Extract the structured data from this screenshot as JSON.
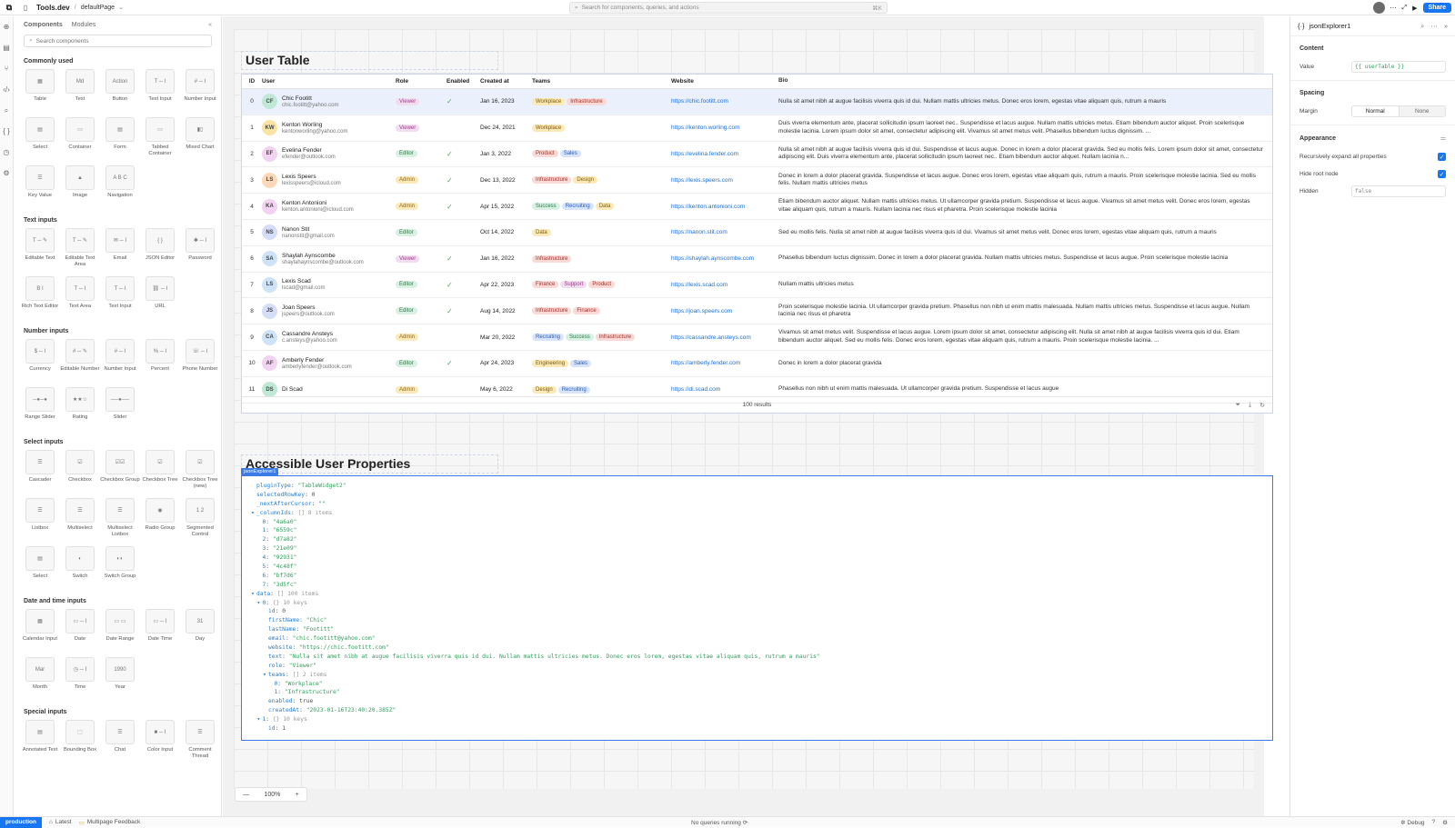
{
  "topbar": {
    "app_name": "Tools.dev",
    "separator": "/",
    "page_name": "defaultPage",
    "search_placeholder": "Search for components, queries, and actions",
    "search_shortcut": "⌘K",
    "share_label": "Share"
  },
  "left": {
    "tabs": [
      "Components",
      "Modules"
    ],
    "search_placeholder": "Search components",
    "cat_common": "Commonly used",
    "common": [
      {
        "l": "Table",
        "t": "▦"
      },
      {
        "l": "Text",
        "t": "Md"
      },
      {
        "l": "Button",
        "t": "Action"
      },
      {
        "l": "Text Input",
        "t": "T ─ I"
      },
      {
        "l": "Number Input",
        "t": "# ─ I"
      },
      {
        "l": "Select",
        "t": "▤"
      },
      {
        "l": "Container",
        "t": "▭"
      },
      {
        "l": "Form",
        "t": "▤"
      },
      {
        "l": "Tabbed Container",
        "t": "▭"
      },
      {
        "l": "Mixed Chart",
        "t": "▮▯"
      },
      {
        "l": "Key Value",
        "t": "☰"
      },
      {
        "l": "Image",
        "t": "▲"
      },
      {
        "l": "Navigation",
        "t": "A B C"
      }
    ],
    "cat_text": "Text inputs",
    "text": [
      {
        "l": "Editable Text",
        "t": "T ─ ✎"
      },
      {
        "l": "Editable Text Area",
        "t": "T ─ ✎"
      },
      {
        "l": "Email",
        "t": "✉ ─ I"
      },
      {
        "l": "JSON Editor",
        "t": "{ }"
      },
      {
        "l": "Password",
        "t": "✱ ─ I"
      },
      {
        "l": "Rich Text Editor",
        "t": "B I"
      },
      {
        "l": "Text Area",
        "t": "T ─ I"
      },
      {
        "l": "Text Input",
        "t": "T ─ I"
      },
      {
        "l": "URL",
        "t": "⛓ ─ I"
      }
    ],
    "cat_number": "Number inputs",
    "number": [
      {
        "l": "Currency",
        "t": "$ ─ I"
      },
      {
        "l": "Editable Number",
        "t": "# ─ ✎"
      },
      {
        "l": "Number Input",
        "t": "# ─ I"
      },
      {
        "l": "Percent",
        "t": "% ─ I"
      },
      {
        "l": "Phone Number",
        "t": "☏ ─ I"
      },
      {
        "l": "Range Slider",
        "t": "─●─●"
      },
      {
        "l": "Rating",
        "t": "★★☆"
      },
      {
        "l": "Slider",
        "t": "──●──"
      }
    ],
    "cat_select": "Select inputs",
    "select": [
      {
        "l": "Cascader",
        "t": "☰"
      },
      {
        "l": "Checkbox",
        "t": "☑"
      },
      {
        "l": "Checkbox Group",
        "t": "☑☑"
      },
      {
        "l": "Checkbox Tree",
        "t": "☑"
      },
      {
        "l": "Checkbox Tree (new)",
        "t": "☑"
      },
      {
        "l": "Listbox",
        "t": "☰"
      },
      {
        "l": "Multiselect",
        "t": "☰"
      },
      {
        "l": "Multiselect Listbox",
        "t": "☰"
      },
      {
        "l": "Radio Group",
        "t": "◉"
      },
      {
        "l": "Segmented Control",
        "t": "1 2"
      },
      {
        "l": "Select",
        "t": "▤"
      },
      {
        "l": "Switch",
        "t": "◐"
      },
      {
        "l": "Switch Group",
        "t": "◐◐"
      }
    ],
    "cat_date": "Date and time inputs",
    "date": [
      {
        "l": "Calendar Input",
        "t": "▦"
      },
      {
        "l": "Date",
        "t": "▭ ─ I"
      },
      {
        "l": "Date Range",
        "t": "▭ ▭"
      },
      {
        "l": "Date Time",
        "t": "▭ ─ I"
      },
      {
        "l": "Day",
        "t": "31"
      },
      {
        "l": "Month",
        "t": "Mar"
      },
      {
        "l": "Time",
        "t": "◷ ─ I"
      },
      {
        "l": "Year",
        "t": "1990"
      }
    ],
    "cat_special": "Special inputs",
    "special": [
      {
        "l": "Annotated Text",
        "t": "▤"
      },
      {
        "l": "Bounding Box",
        "t": "⬚"
      },
      {
        "l": "Chat",
        "t": "☰"
      },
      {
        "l": "Color Input",
        "t": "■ ─ I"
      },
      {
        "l": "Comment Thread",
        "t": "☰"
      }
    ],
    "new_label": "New"
  },
  "table": {
    "title": "User Table",
    "columns": [
      "ID",
      "User",
      "Role",
      "Enabled",
      "Created at",
      "Teams",
      "Website",
      "Bio"
    ],
    "rows": [
      {
        "id": "0",
        "ini": "CF",
        "av": "#bfe9d6",
        "name": "Chic Footitt",
        "email": "chic.footitt@yahoo.com",
        "role": "Viewer",
        "en": true,
        "created": "Jan 16, 2023",
        "teams": [
          "Workplace",
          "Infrastructure"
        ],
        "web": "https://chic.footitt.com",
        "bio": "Nulla sit amet nibh at augue facilisis viverra quis id dui. Nullam mattis ultricies metus. Donec eros lorem, egestas vitae aliquam quis, rutrum a mauris"
      },
      {
        "id": "1",
        "ini": "KW",
        "av": "#fbe3a2",
        "name": "Kenton Worling",
        "email": "kentonworling@yahoo.com",
        "role": "Viewer",
        "en": false,
        "created": "Dec 24, 2021",
        "teams": [
          "Workplace"
        ],
        "web": "https://kenton.worling.com",
        "bio": "Duis viverra elementum ante, placerat sollicitudin ipsum laoreet nec.. Suspendisse et lacus augue. Nullam mattis ultricies metus. Etiam bibendum auctor aliquet. Proin scelerisque molestie lacinia. Lorem ipsum dolor sit amet, consectetur adipiscing elit. Vivamus sit amet metus velit. Phasellus bibendum luctus dignissim. ..."
      },
      {
        "id": "2",
        "ini": "EF",
        "av": "#f2d3f1",
        "name": "Evelina Fender",
        "email": "efender@outlook.com",
        "role": "Editor",
        "en": true,
        "created": "Jan 3, 2022",
        "teams": [
          "Product",
          "Sales"
        ],
        "web": "https://evelina.fender.com",
        "bio": "Nulla sit amet nibh at augue facilisis viverra quis id dui. Suspendisse et lacus augue. Donec in lorem a dolor placerat gravida. Sed eu mollis felis. Lorem ipsum dolor sit amet, consectetur adipiscing elit. Duis viverra elementum ante, placerat sollicitudin ipsum laoreet nec.. Etiam bibendum auctor aliquet. Nullam lacinia n..."
      },
      {
        "id": "3",
        "ini": "LS",
        "av": "#fbd9b8",
        "name": "Lexis Speers",
        "email": "lexisspeers@icloud.com",
        "role": "Admin",
        "en": true,
        "created": "Dec 13, 2022",
        "teams": [
          "Infrastructure",
          "Design"
        ],
        "web": "https://lexis.speers.com",
        "bio": "Donec in lorem a dolor placerat gravida. Suspendisse et lacus augue. Donec eros lorem, egestas vitae aliquam quis, rutrum a mauris. Proin scelerisque molestie lacinia. Sed eu mollis felis. Nullam mattis ultricies metus"
      },
      {
        "id": "4",
        "ini": "KA",
        "av": "#f2d3f1",
        "name": "Kenton Antonioni",
        "email": "kenton.antonioni@icloud.com",
        "role": "Admin",
        "en": true,
        "created": "Apr 15, 2022",
        "teams": [
          "Success",
          "Recruiting",
          "Data"
        ],
        "web": "https://kenton.antonioni.com",
        "bio": "Etiam bibendum auctor aliquet. Nullam mattis ultricies metus. Ut ullamcorper gravida pretium. Suspendisse et lacus augue. Vivamus sit amet metus velit. Donec eros lorem, egestas vitae aliquam quis, rutrum a mauris. Nullam lacinia nec risus et pharetra. Proin scelerisque molestie lacinia"
      },
      {
        "id": "5",
        "ini": "NS",
        "av": "#d6ddf8",
        "name": "Nanon Stit",
        "email": "nanonstit@gmail.com",
        "role": "Editor",
        "en": false,
        "created": "Oct 14, 2022",
        "teams": [
          "Data"
        ],
        "web": "https://nanon.stit.com",
        "bio": "Sed eu mollis felis. Nulla sit amet nibh at augue facilisis viverra quis id dui. Vivamus sit amet metus velit. Donec eros lorem, egestas vitae aliquam quis, rutrum a mauris"
      },
      {
        "id": "6",
        "ini": "SA",
        "av": "#cfe3f7",
        "name": "Shaylah Aynscombe",
        "email": "shaylahaynscombe@outlook.com",
        "role": "Viewer",
        "en": true,
        "created": "Jan 16, 2022",
        "teams": [
          "Infrastructure"
        ],
        "web": "https://shaylah.aynscombe.com",
        "bio": "Phasellus bibendum luctus dignissim. Donec in lorem a dolor placerat gravida. Nullam mattis ultricies metus. Suspendisse et lacus augue. Proin scelerisque molestie lacinia"
      },
      {
        "id": "7",
        "ini": "LS",
        "av": "#cfe3f7",
        "name": "Lexis Scad",
        "email": "lscad@gmail.com",
        "role": "Editor",
        "en": true,
        "created": "Apr 22, 2023",
        "teams": [
          "Finance",
          "Support",
          "Product"
        ],
        "web": "https://lexis.scad.com",
        "bio": "Nullam mattis ultricies metus"
      },
      {
        "id": "8",
        "ini": "JS",
        "av": "#d6ddf8",
        "name": "Joan Speers",
        "email": "jspeers@outlook.com",
        "role": "Editor",
        "en": true,
        "created": "Aug 14, 2022",
        "teams": [
          "Infrastructure",
          "Finance"
        ],
        "web": "https://joan.speers.com",
        "bio": "Proin scelerisque molestie lacinia. Ut ullamcorper gravida pretium. Phasellus non nibh ut enim mattis malesuada. Nullam mattis ultricies metus. Suspendisse et lacus augue. Nullam lacinia nec risus et pharetra"
      },
      {
        "id": "9",
        "ini": "CA",
        "av": "#cfe3f7",
        "name": "Cassandre Ansteys",
        "email": "c.ansteys@yahoo.com",
        "role": "Admin",
        "en": false,
        "created": "Mar 20, 2022",
        "teams": [
          "Recruiting",
          "Success",
          "Infrastructure"
        ],
        "web": "https://cassandre.ansteys.com",
        "bio": "Vivamus sit amet metus velit. Suspendisse et lacus augue. Lorem ipsum dolor sit amet, consectetur adipiscing elit. Nulla sit amet nibh at augue facilisis viverra quis id dui. Etiam bibendum auctor aliquet. Sed eu mollis felis. Donec eros lorem, egestas vitae aliquam quis, rutrum a mauris. Proin scelerisque molestie lacinia. ..."
      },
      {
        "id": "10",
        "ini": "AF",
        "av": "#f2d3f1",
        "name": "Amberly Fender",
        "email": "amberlyfender@outlook.com",
        "role": "Editor",
        "en": true,
        "created": "Apr 24, 2023",
        "teams": [
          "Engineering",
          "Sales"
        ],
        "web": "https://amberly.fender.com",
        "bio": "Donec in lorem a dolor placerat gravida"
      },
      {
        "id": "11",
        "ini": "DS",
        "av": "#bfe9d6",
        "name": "Di Scad",
        "email": "",
        "role": "Admin",
        "en": false,
        "created": "May 6, 2022",
        "teams": [
          "Design",
          "Recruiting"
        ],
        "web": "https://di.scad.com",
        "bio": "Phasellus non nibh ut enim mattis malesuada. Ut ullamcorper gravida pretium. Suspendisse et lacus augue"
      }
    ],
    "results": "100 results"
  },
  "roleColors": {
    "Viewer": [
      "#f4dcef",
      "#9c3d8c"
    ],
    "Editor": [
      "#d8f1e3",
      "#2c7a4c"
    ],
    "Admin": [
      "#fde9b8",
      "#8a6a10"
    ]
  },
  "teamColors": {
    "Workplace": [
      "#fde9b8",
      "#7a5b0a"
    ],
    "Infrastructure": [
      "#fad9d6",
      "#a2322a"
    ],
    "Product": [
      "#fad9d6",
      "#a2322a"
    ],
    "Sales": [
      "#d8e4fb",
      "#2a5bb0"
    ],
    "Design": [
      "#fde9b8",
      "#7a5b0a"
    ],
    "Success": [
      "#d8f1e3",
      "#2c7a4c"
    ],
    "Recruiting": [
      "#d8e4fb",
      "#2a5bb0"
    ],
    "Data": [
      "#fde9b8",
      "#7a5b0a"
    ],
    "Finance": [
      "#fad9d6",
      "#a2322a"
    ],
    "Support": [
      "#f4dcef",
      "#9c3d8c"
    ],
    "Engineering": [
      "#fde9b8",
      "#7a5b0a"
    ]
  },
  "json": {
    "title": "Accessible User Properties",
    "selected_badge": "jsonExplorer1",
    "lines": [
      {
        "i": 0,
        "t": "",
        "k": "pluginType",
        "v": "\"TableWidget2\"",
        "s": true
      },
      {
        "i": 0,
        "t": "",
        "k": "selectedRowKey",
        "v": "0",
        "s": false
      },
      {
        "i": 0,
        "t": "",
        "k": "_nextAfterCursor",
        "v": "\"\"",
        "s": true
      },
      {
        "i": 0,
        "t": "▾",
        "k": "_columnIds",
        "v": "[] 8 items",
        "s": false,
        "c": true
      },
      {
        "i": 1,
        "t": "",
        "k": "0",
        "v": "\"4a6a0\"",
        "s": true
      },
      {
        "i": 1,
        "t": "",
        "k": "1",
        "v": "\"6559c\"",
        "s": true
      },
      {
        "i": 1,
        "t": "",
        "k": "2",
        "v": "\"d7a82\"",
        "s": true
      },
      {
        "i": 1,
        "t": "",
        "k": "3",
        "v": "\"21e09\"",
        "s": true
      },
      {
        "i": 1,
        "t": "",
        "k": "4",
        "v": "\"92931\"",
        "s": true
      },
      {
        "i": 1,
        "t": "",
        "k": "5",
        "v": "\"4c48f\"",
        "s": true
      },
      {
        "i": 1,
        "t": "",
        "k": "6",
        "v": "\"bf7d6\"",
        "s": true
      },
      {
        "i": 1,
        "t": "",
        "k": "7",
        "v": "\"3d5fc\"",
        "s": true
      },
      {
        "i": 0,
        "t": "▾",
        "k": "data",
        "v": "[] 100 items",
        "s": false,
        "c": true
      },
      {
        "i": 1,
        "t": "▾",
        "k": "0",
        "v": "{} 10 keys",
        "s": false,
        "c": true
      },
      {
        "i": 2,
        "t": "",
        "k": "id",
        "v": "0",
        "s": false
      },
      {
        "i": 2,
        "t": "",
        "k": "firstName",
        "v": "\"Chic\"",
        "s": true
      },
      {
        "i": 2,
        "t": "",
        "k": "lastName",
        "v": "\"Footitt\"",
        "s": true
      },
      {
        "i": 2,
        "t": "",
        "k": "email",
        "v": "\"chic.footitt@yahoo.com\"",
        "s": true
      },
      {
        "i": 2,
        "t": "",
        "k": "website",
        "v": "\"https://chic.footitt.com\"",
        "s": true
      },
      {
        "i": 2,
        "t": "",
        "k": "text",
        "v": "\"Nulla sit amet nibh at augue facilisis viverra quis id dui. Nullam mattis ultricies metus. Donec eros lorem, egestas vitae aliquam quis, rutrum a mauris\"",
        "s": true
      },
      {
        "i": 2,
        "t": "",
        "k": "role",
        "v": "\"Viewer\"",
        "s": true
      },
      {
        "i": 2,
        "t": "▾",
        "k": "teams",
        "v": "[] 2 items",
        "s": false,
        "c": true
      },
      {
        "i": 3,
        "t": "",
        "k": "0",
        "v": "\"Workplace\"",
        "s": true
      },
      {
        "i": 3,
        "t": "",
        "k": "1",
        "v": "\"Infrastructure\"",
        "s": true
      },
      {
        "i": 2,
        "t": "",
        "k": "enabled",
        "v": "true",
        "s": false
      },
      {
        "i": 2,
        "t": "",
        "k": "createdAt",
        "v": "\"2023-01-16T23:40:20.385Z\"",
        "s": true
      },
      {
        "i": 1,
        "t": "▾",
        "k": "1",
        "v": "{} 10 keys",
        "s": false,
        "c": true
      },
      {
        "i": 2,
        "t": "",
        "k": "id",
        "v": "1",
        "s": false
      }
    ]
  },
  "zoom": {
    "minus": "—",
    "level": "100%",
    "plus": "+"
  },
  "right": {
    "component": "jsonExplorer1",
    "content_title": "Content",
    "value_label": "Value",
    "value": "{{ userTable }}",
    "spacing_title": "Spacing",
    "margin_label": "Margin",
    "margin_options": [
      "Normal",
      "None"
    ],
    "appearance_title": "Appearance",
    "expand_label": "Recursively expand all properties",
    "hideroot_label": "Hide root node",
    "hidden_label": "Hidden",
    "hidden_value": "false"
  },
  "status": {
    "env": "production",
    "latest": "Latest",
    "feedback": "Multipage Feedback",
    "queries": "No queries running",
    "debug": "Debug"
  }
}
